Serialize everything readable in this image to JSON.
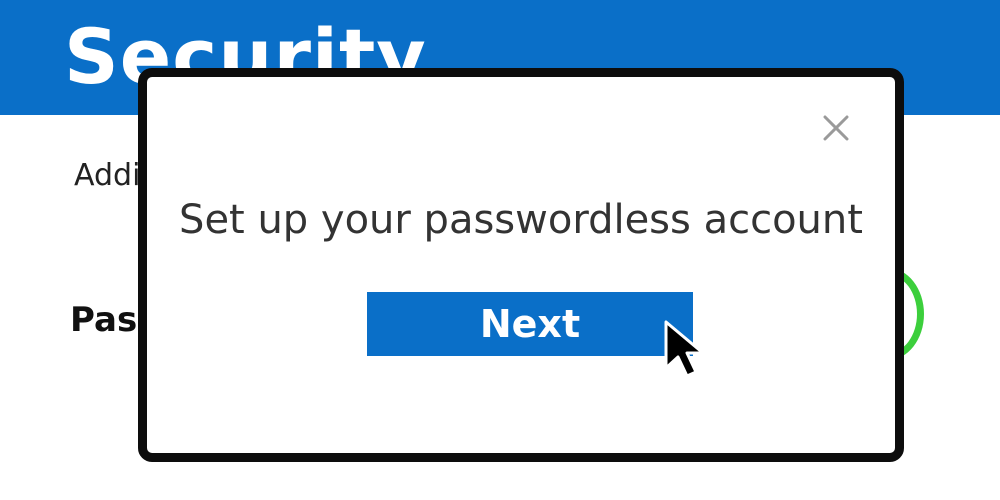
{
  "page": {
    "title": "Security",
    "subtitle_visible": "Addi",
    "section_title_visible": "Pas"
  },
  "modal": {
    "heading": "Set up your passwordless account",
    "next_label": "Next",
    "close_icon": "close-icon"
  },
  "cursor": {
    "icon": "mouse-pointer-icon"
  },
  "colors": {
    "brand_blue": "#0a6fc8",
    "status_green": "#3ccf3c",
    "heading_text": "#333333",
    "close_icon": "#9a9a9a"
  }
}
